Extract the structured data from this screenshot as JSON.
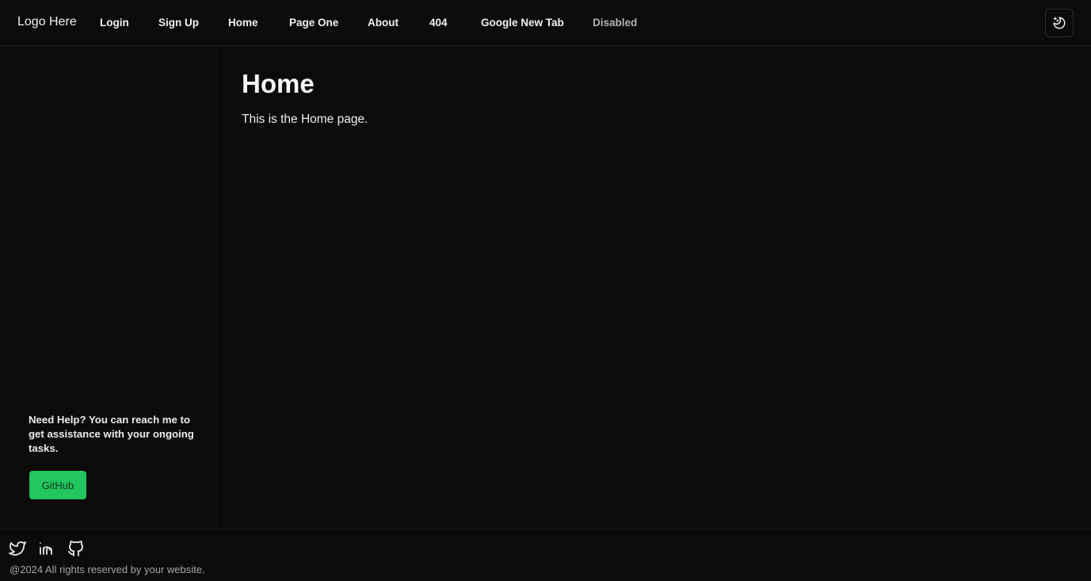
{
  "navbar": {
    "logo": "Logo Here",
    "links": [
      {
        "label": "Login"
      },
      {
        "label": "Sign Up"
      },
      {
        "label": "Home"
      },
      {
        "label": "Page One"
      },
      {
        "label": "About"
      },
      {
        "label": "404"
      },
      {
        "label": "Google New Tab"
      },
      {
        "label": "Disabled"
      }
    ],
    "theme_toggle_icon": "moon-stars-icon"
  },
  "sidebar": {
    "help_text": "Need Help? You can reach me to get assistance with your ongoing tasks.",
    "github_button": "GitHub",
    "github_button_color": "#22c55e"
  },
  "main": {
    "title": "Home",
    "description": "This is the Home page."
  },
  "footer": {
    "social_icons": [
      "twitter-icon",
      "linkedin-icon",
      "github-icon"
    ],
    "copyright": "@2024 All rights reserved by your website."
  }
}
